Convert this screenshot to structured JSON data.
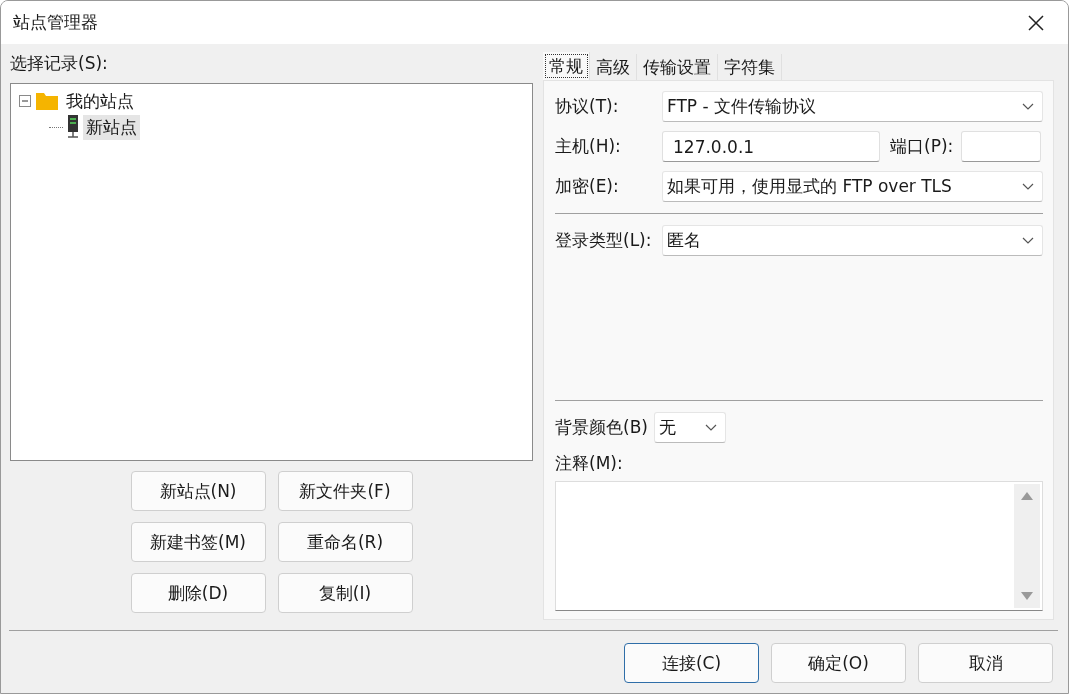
{
  "window": {
    "title": "站点管理器"
  },
  "site_list": {
    "label": "选择记录(S):",
    "tree": [
      {
        "label": "我的站点",
        "kind": "folder",
        "expanded": true,
        "selected": false,
        "children": [
          {
            "label": "新站点",
            "kind": "site",
            "selected": true
          }
        ]
      }
    ]
  },
  "site_buttons": [
    "新站点(N)",
    "新文件夹(F)",
    "新建书签(M)",
    "重命名(R)",
    "删除(D)",
    "复制(I)"
  ],
  "tabs": [
    {
      "label": "常规",
      "selected": true
    },
    {
      "label": "高级",
      "selected": false
    },
    {
      "label": "传输设置",
      "selected": false
    },
    {
      "label": "字符集",
      "selected": false
    }
  ],
  "general": {
    "protocol": {
      "label": "协议(T):",
      "value": "FTP - 文件传输协议"
    },
    "host": {
      "label": "主机(H):",
      "value": "127.0.0.1"
    },
    "port": {
      "label": "端口(P):"
    },
    "encryption": {
      "label": "加密(E):",
      "value": "如果可用，使用显式的 FTP over TLS"
    },
    "logon_type": {
      "label": "登录类型(L):",
      "value": "匿名"
    },
    "background_color": {
      "label": "背景颜色(B)",
      "value": "无"
    },
    "comments": {
      "label": "注释(M):"
    }
  },
  "dialog_buttons": [
    {
      "label": "连接(C)",
      "default": true
    },
    {
      "label": "确定(O)",
      "default": false
    },
    {
      "label": "取消",
      "default": false
    }
  ]
}
